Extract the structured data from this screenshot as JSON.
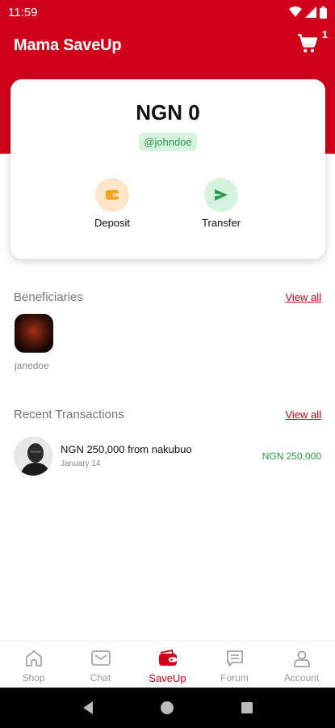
{
  "status_bar": {
    "time": "11:59"
  },
  "app": {
    "title": "Mama SaveUp",
    "cart_count": "1"
  },
  "wallet": {
    "balance": "NGN 0",
    "handle": "@johndoe",
    "actions": [
      {
        "label": "Deposit",
        "icon": "wallet-icon",
        "color": "#f5a623"
      },
      {
        "label": "Transfer",
        "icon": "send-icon",
        "color": "#2b9a4a"
      }
    ]
  },
  "beneficiaries": {
    "title": "Beneficiaries",
    "view_all": "View all",
    "items": [
      {
        "name": "janedoe"
      }
    ]
  },
  "transactions": {
    "title": "Recent Transactions",
    "view_all": "View all",
    "items": [
      {
        "title": "NGN 250,000 from nakubuo",
        "date": "January 14",
        "amount": "NGN 250,000"
      }
    ]
  },
  "bottom_nav": {
    "active": "SaveUp",
    "items": [
      {
        "label": "Shop",
        "icon": "shop-icon"
      },
      {
        "label": "Chat",
        "icon": "chat-icon"
      },
      {
        "label": "SaveUp",
        "icon": "wallet-icon"
      },
      {
        "label": "Forum",
        "icon": "forum-icon"
      },
      {
        "label": "Account",
        "icon": "account-icon"
      }
    ]
  },
  "colors": {
    "brand": "#d0021b",
    "success": "#2b9a4a",
    "deposit": "#f5a623"
  }
}
